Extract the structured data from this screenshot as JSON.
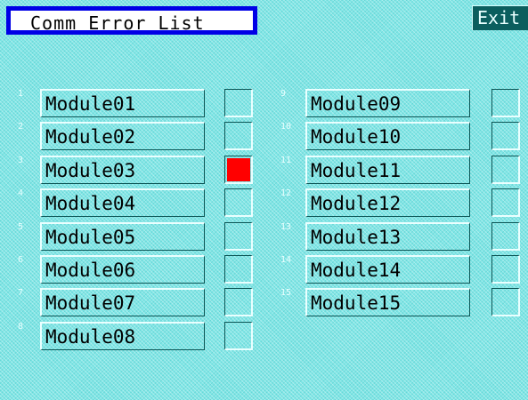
{
  "title": "Comm Error List",
  "exit_label": "Exit",
  "colors": {
    "error": "#ff0000",
    "ok": "transparent",
    "title_border": "#0000e6"
  },
  "modules": [
    {
      "index": "1",
      "name": "Module01",
      "error": false
    },
    {
      "index": "2",
      "name": "Module02",
      "error": false
    },
    {
      "index": "3",
      "name": "Module03",
      "error": true
    },
    {
      "index": "4",
      "name": "Module04",
      "error": false
    },
    {
      "index": "5",
      "name": "Module05",
      "error": false
    },
    {
      "index": "6",
      "name": "Module06",
      "error": false
    },
    {
      "index": "7",
      "name": "Module07",
      "error": false
    },
    {
      "index": "8",
      "name": "Module08",
      "error": false
    },
    {
      "index": "9",
      "name": "Module09",
      "error": false
    },
    {
      "index": "10",
      "name": "Module10",
      "error": false
    },
    {
      "index": "11",
      "name": "Module11",
      "error": false
    },
    {
      "index": "12",
      "name": "Module12",
      "error": false
    },
    {
      "index": "13",
      "name": "Module13",
      "error": false
    },
    {
      "index": "14",
      "name": "Module14",
      "error": false
    },
    {
      "index": "15",
      "name": "Module15",
      "error": false
    }
  ]
}
